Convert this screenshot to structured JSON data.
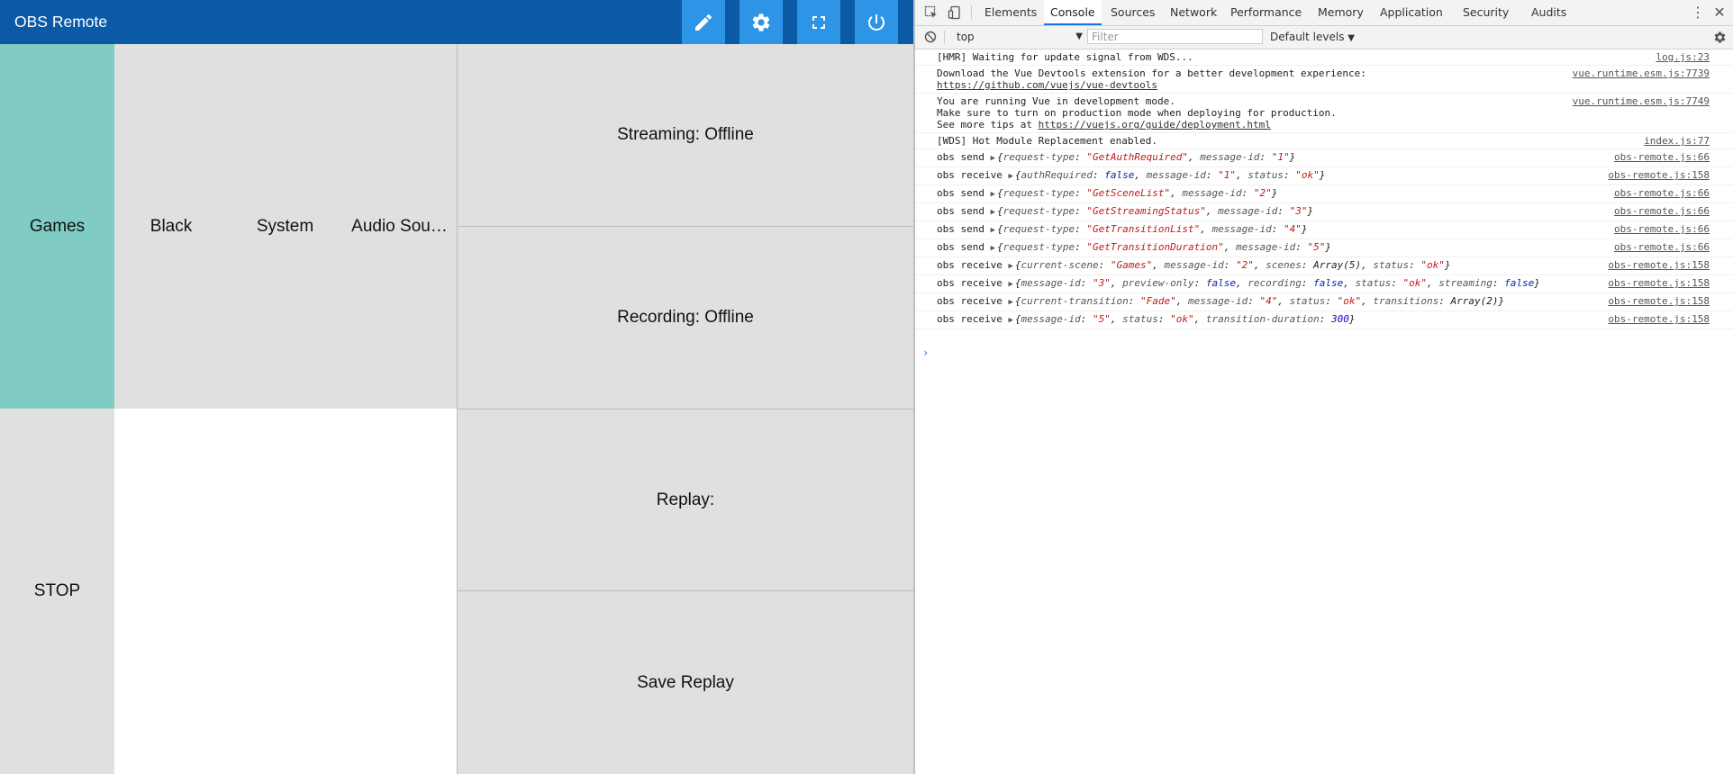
{
  "app": {
    "title": "OBS Remote",
    "toolbar_icons": [
      "pencil-icon",
      "gear-icon",
      "fullscreen-icon",
      "power-icon"
    ],
    "accent_color": "#0b5aa6",
    "button_color": "#2e94e6",
    "active_scene_color": "#80cbc4",
    "scenes": [
      "Games",
      "Black",
      "System",
      "Audio Sou…"
    ],
    "active_scene": "Games",
    "stop_label": "STOP",
    "streaming_status": "Streaming: Offline",
    "recording_status": "Recording: Offline",
    "replay_status": "Replay:",
    "save_replay_label": "Save Replay"
  },
  "devtools": {
    "tabs": [
      "Elements",
      "Console",
      "Sources",
      "Network",
      "Performance",
      "Memory",
      "Application",
      "Security",
      "Audits"
    ],
    "active_tab": "Console",
    "context": "top",
    "filter_placeholder": "Filter",
    "levels": "Default levels",
    "messages": [
      {
        "text": "[HMR] Waiting for update signal from WDS...",
        "source": "log.js:23"
      },
      {
        "text": "Download the Vue Devtools extension for a better development experience:",
        "link": "https://github.com/vuejs/vue-devtools",
        "source": "vue.runtime.esm.js:7739"
      },
      {
        "text": "You are running Vue in development mode.\nMake sure to turn on production mode when deploying for production.\nSee more tips at ",
        "link": "https://vuejs.org/guide/deployment.html",
        "source": "vue.runtime.esm.js:7749"
      },
      {
        "text": "[WDS] Hot Module Replacement enabled.",
        "source": "index.js:77"
      },
      {
        "prefix": "obs send",
        "obj": [
          [
            "request-type",
            "\"GetAuthRequired\"",
            "s"
          ],
          [
            "message-id",
            "\"1\"",
            "s"
          ]
        ],
        "source": "obs-remote.js:66"
      },
      {
        "prefix": "obs receive",
        "obj": [
          [
            "authRequired",
            "false",
            "b"
          ],
          [
            "message-id",
            "\"1\"",
            "s"
          ],
          [
            "status",
            "\"ok\"",
            "s"
          ]
        ],
        "source": "obs-remote.js:158"
      },
      {
        "prefix": "obs send",
        "obj": [
          [
            "request-type",
            "\"GetSceneList\"",
            "s"
          ],
          [
            "message-id",
            "\"2\"",
            "s"
          ]
        ],
        "source": "obs-remote.js:66"
      },
      {
        "prefix": "obs send",
        "obj": [
          [
            "request-type",
            "\"GetStreamingStatus\"",
            "s"
          ],
          [
            "message-id",
            "\"3\"",
            "s"
          ]
        ],
        "source": "obs-remote.js:66"
      },
      {
        "prefix": "obs send",
        "obj": [
          [
            "request-type",
            "\"GetTransitionList\"",
            "s"
          ],
          [
            "message-id",
            "\"4\"",
            "s"
          ]
        ],
        "source": "obs-remote.js:66"
      },
      {
        "prefix": "obs send",
        "obj": [
          [
            "request-type",
            "\"GetTransitionDuration\"",
            "s"
          ],
          [
            "message-id",
            "\"5\"",
            "s"
          ]
        ],
        "source": "obs-remote.js:66"
      },
      {
        "prefix": "obs receive",
        "obj": [
          [
            "current-scene",
            "\"Games\"",
            "s"
          ],
          [
            "message-id",
            "\"2\"",
            "s"
          ],
          [
            "scenes",
            "Array(5)",
            "p"
          ],
          [
            "status",
            "\"ok\"",
            "s"
          ]
        ],
        "source": "obs-remote.js:158"
      },
      {
        "prefix": "obs receive",
        "obj": [
          [
            "message-id",
            "\"3\"",
            "s"
          ],
          [
            "preview-only",
            "false",
            "b"
          ],
          [
            "recording",
            "false",
            "b"
          ],
          [
            "status",
            "\"ok\"",
            "s"
          ],
          [
            "streaming",
            "false",
            "b"
          ]
        ],
        "source": "obs-remote.js:158"
      },
      {
        "prefix": "obs receive",
        "obj": [
          [
            "current-transition",
            "\"Fade\"",
            "s"
          ],
          [
            "message-id",
            "\"4\"",
            "s"
          ],
          [
            "status",
            "\"ok\"",
            "s"
          ],
          [
            "transitions",
            "Array(2)",
            "p"
          ]
        ],
        "source": "obs-remote.js:158"
      },
      {
        "prefix": "obs receive",
        "obj": [
          [
            "message-id",
            "\"5\"",
            "s"
          ],
          [
            "status",
            "\"ok\"",
            "s"
          ],
          [
            "transition-duration",
            "300",
            "n"
          ]
        ],
        "source": "obs-remote.js:158"
      }
    ],
    "prompt": "›"
  }
}
